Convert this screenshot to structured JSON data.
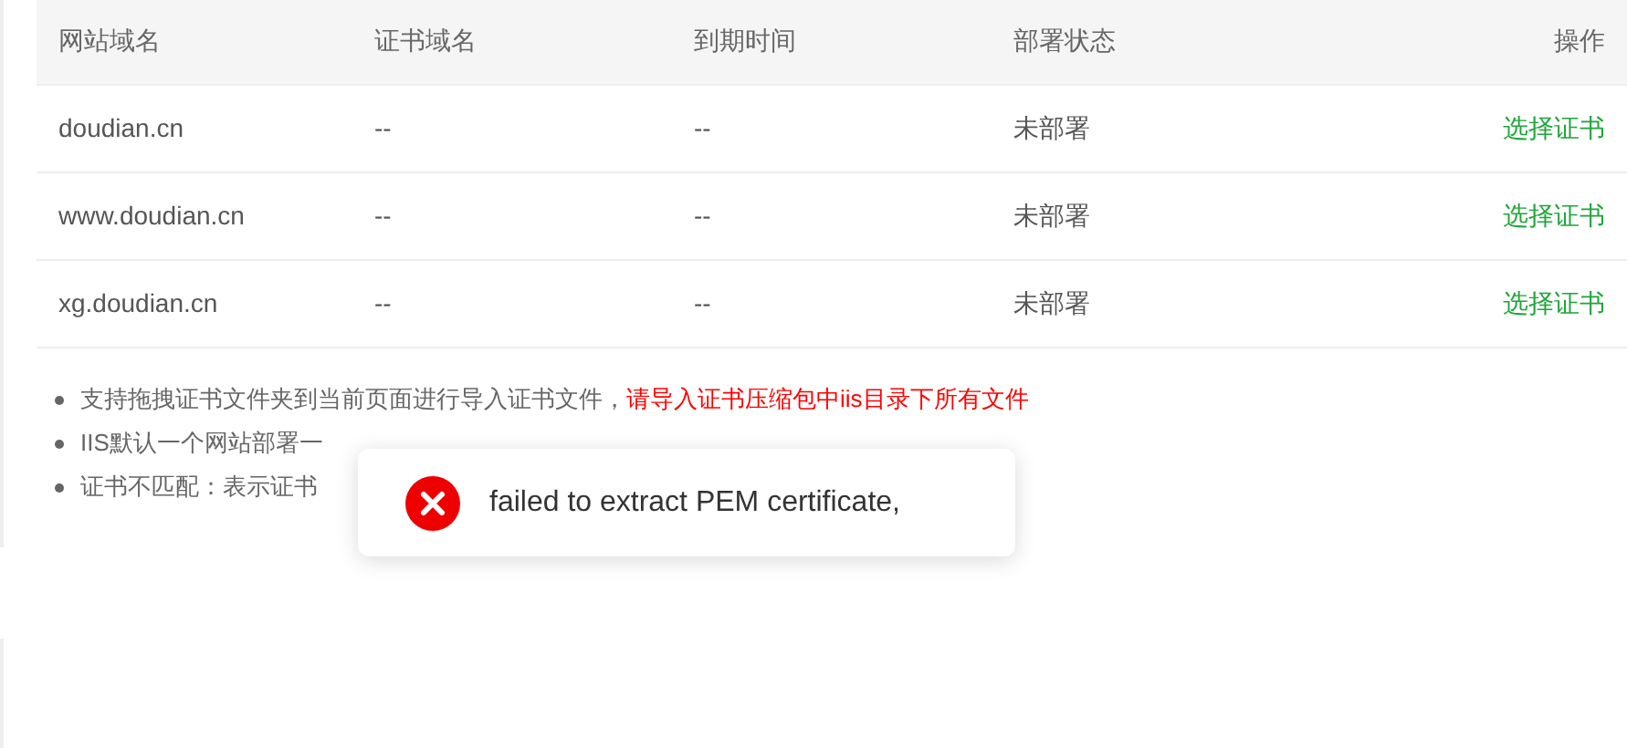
{
  "table": {
    "columns": [
      "网站域名",
      "证书域名",
      "到期时间",
      "部署状态",
      "操作"
    ],
    "rows": [
      {
        "site_domain": "doudian.cn",
        "cert_domain": "--",
        "expiry": "--",
        "status": "未部署",
        "action": "选择证书"
      },
      {
        "site_domain": "www.doudian.cn",
        "cert_domain": "--",
        "expiry": "--",
        "status": "未部署",
        "action": "选择证书"
      },
      {
        "site_domain": "xg.doudian.cn",
        "cert_domain": "--",
        "expiry": "--",
        "status": "未部署",
        "action": "选择证书"
      }
    ]
  },
  "notes": [
    {
      "text": "支持拖拽证书文件夹到当前页面进行导入证书文件，",
      "highlight": "请导入证书压缩包中iis目录下所有文件"
    },
    {
      "text": "IIS默认一个网站部署一"
    },
    {
      "text": "证书不匹配：表示证书"
    }
  ],
  "toast": {
    "kind": "error",
    "message": "failed to extract PEM certificate,"
  }
}
